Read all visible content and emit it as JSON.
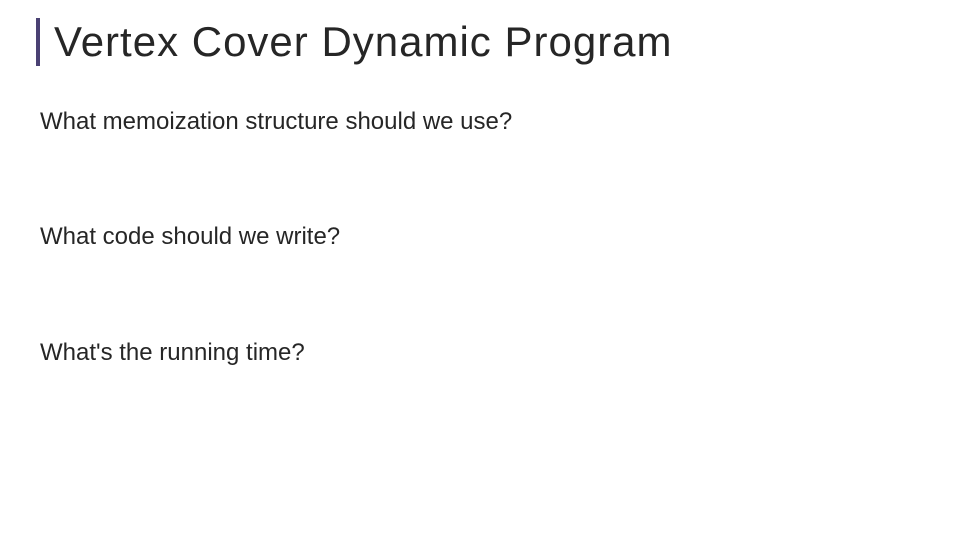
{
  "title": "Vertex Cover Dynamic Program",
  "questions": [
    "What memoization structure should we use?",
    "What code should we write?",
    "What's the running time?"
  ],
  "accent_color": "#4a4173"
}
